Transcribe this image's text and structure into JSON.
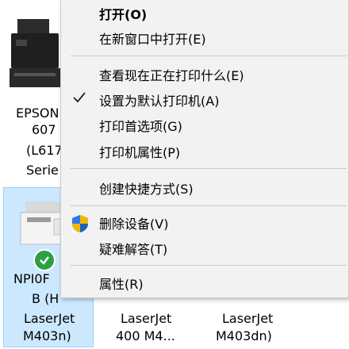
{
  "devices": [
    {
      "name_lines": [
        "EPSON",
        "607",
        "(L617",
        "Serie"
      ]
    },
    {
      "name_lines": [
        "NPI0F",
        "B (H",
        "LaserJet",
        "M403n)"
      ]
    },
    {
      "name_lines": [
        "",
        "LaserJet",
        "400 M4..."
      ]
    },
    {
      "name_lines": [
        "",
        "LaserJet",
        "M403dn)"
      ]
    }
  ],
  "context_menu": {
    "items": [
      {
        "label": "打开(O)"
      },
      {
        "label": "在新窗口中打开(E)"
      },
      {
        "label": "查看现在正在打印什么(E)"
      },
      {
        "label": "设置为默认打印机(A)"
      },
      {
        "label": "打印首选项(G)"
      },
      {
        "label": "打印机属性(P)"
      },
      {
        "label": "创建快捷方式(S)"
      },
      {
        "label": "删除设备(V)"
      },
      {
        "label": "疑难解答(T)"
      },
      {
        "label": "属性(R)"
      }
    ]
  },
  "icons": {
    "default_check": "checkmark-icon",
    "admin": "uac-shield-icon"
  }
}
